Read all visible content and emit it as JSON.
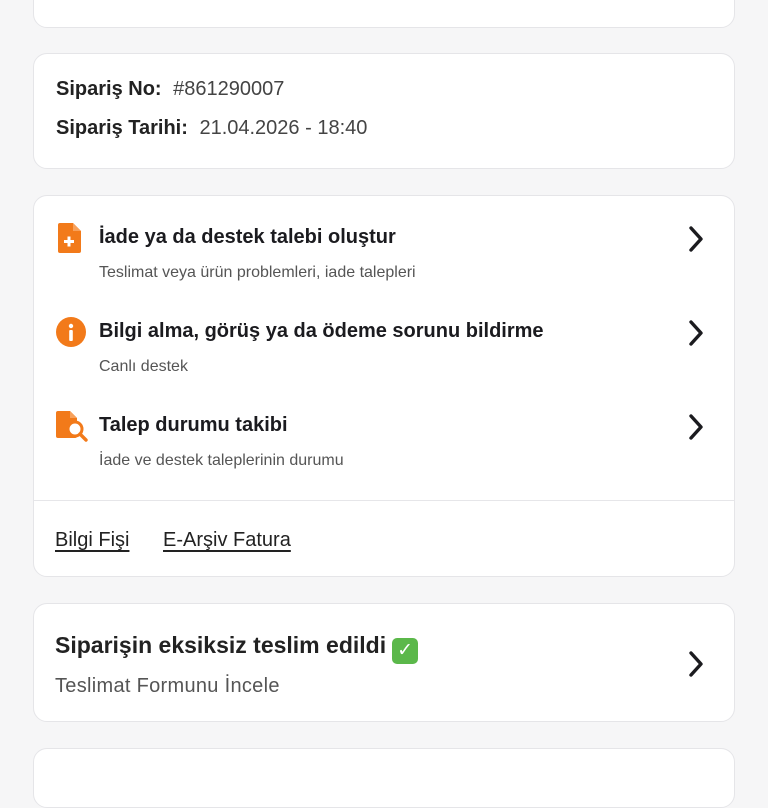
{
  "order": {
    "number_label": "Sipariş No:",
    "number_value": "#861290007",
    "date_label": "Sipariş Tarihi:",
    "date_value": "21.04.2026 - 18:40"
  },
  "support": {
    "items": [
      {
        "title": "İade ya da destek talebi oluştur",
        "subtitle": "Teslimat veya ürün problemleri, iade talepleri",
        "icon": "document-plus-icon"
      },
      {
        "title": "Bilgi alma, görüş ya da ödeme sorunu bildirme",
        "subtitle": "Canlı destek",
        "icon": "info-icon"
      },
      {
        "title": "Talep durumu takibi",
        "subtitle": "İade ve destek taleplerinin durumu",
        "icon": "document-search-icon"
      }
    ],
    "links": [
      "Bilgi Fişi",
      "E-Arşiv Fatura"
    ]
  },
  "delivery": {
    "title": "Siparişin eksiksiz teslim edildi",
    "subtitle": "Teslimat Formunu İncele"
  },
  "colors": {
    "accent": "#f27a1a",
    "check": "#5bb84a",
    "star": "#f6c21b"
  }
}
